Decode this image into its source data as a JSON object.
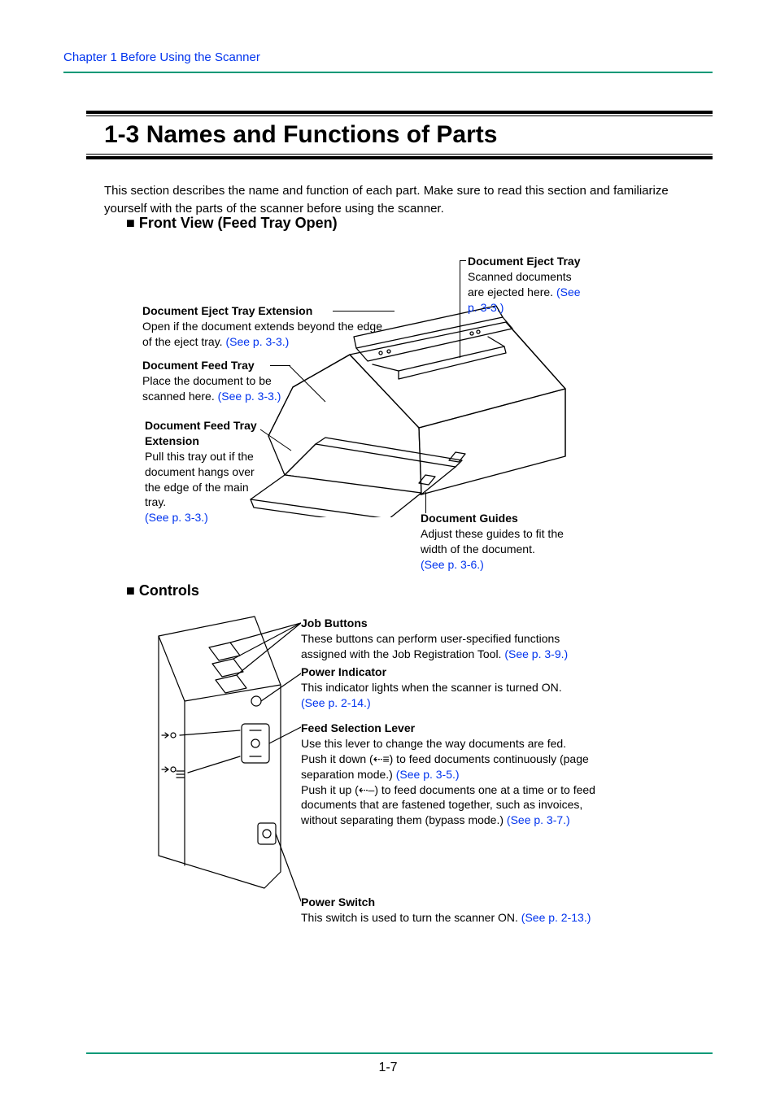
{
  "header_link": "Chapter 1   Before Using the Scanner",
  "heading": "1-3  Names and Functions of Parts",
  "intro": "This section describes the name and function of each part. Make sure to read this section and familiarize yourself with the parts of the scanner before using the scanner.",
  "subhead_front": "Front View (Feed Tray Open)",
  "subhead_controls": "Controls",
  "callouts": {
    "eject_ext": {
      "title": "Document Eject Tray Extension",
      "body": "Open if the document extends beyond the edge of the eject tray. ",
      "link": "(See p. 3-3.)"
    },
    "feed_tray": {
      "title": "Document Feed Tray",
      "body": "Place the document to be scanned here. ",
      "link": "(See p. 3-3.)"
    },
    "feed_ext": {
      "title": "Document Feed Tray Extension",
      "body": "Pull this tray out if the document hangs over the edge of the main tray.",
      "link": "(See p. 3-3.)"
    },
    "eject_tray": {
      "title": "Document Eject Tray",
      "body": "Scanned documents are ejected here. ",
      "link": "(See p. 3-3.)"
    },
    "guides": {
      "title": "Document Guides",
      "body": "Adjust these guides to fit the width of the document.",
      "link": "(See p. 3-6.)"
    },
    "job": {
      "title": "Job Buttons",
      "body": "These buttons can perform user-specified functions assigned with the Job Registration Tool. ",
      "link": "(See p. 3-9.)"
    },
    "power_ind": {
      "title": "Power Indicator",
      "body": "This indicator lights when the scanner is turned ON.",
      "link": "(See p. 2-14.)"
    },
    "feed_lever": {
      "title": "Feed Selection Lever",
      "body1": "Use this lever to change the way documents are fed.",
      "body2a": "Push it down (",
      "glyph1": "⇠≡",
      "body2b": ") to feed documents continuously (page separation mode.) ",
      "link1": "(See p. 3-5.)",
      "body3a": "Push it up (",
      "glyph2": "⇠–",
      "body3b": ") to feed documents one at a time or to feed documents that are fastened together, such as invoices, without separating them (bypass mode.) ",
      "link2": "(See p. 3-7.)"
    },
    "power_sw": {
      "title": "Power Switch",
      "body": "This switch is used to turn the scanner ON. ",
      "link": "(See p. 2-13.)"
    }
  },
  "page_number": "1-7"
}
